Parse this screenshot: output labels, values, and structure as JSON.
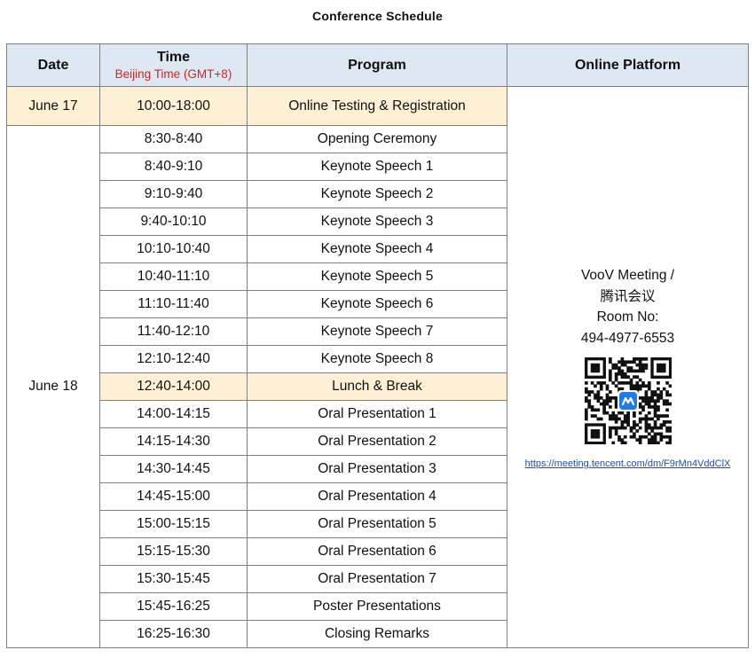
{
  "title": "Conference Schedule",
  "header": {
    "date": "Date",
    "time": "Time",
    "time_sub": "Beijing Time (GMT+8)",
    "program": "Program",
    "platform": "Online Platform"
  },
  "day1": {
    "date": "June 17",
    "time": "10:00-18:00",
    "program": "Online Testing & Registration"
  },
  "day2": {
    "date": "June 18",
    "slots": [
      {
        "time": "8:30-8:40",
        "program": "Opening Ceremony"
      },
      {
        "time": "8:40-9:10",
        "program": "Keynote Speech 1"
      },
      {
        "time": "9:10-9:40",
        "program": "Keynote Speech 2"
      },
      {
        "time": "9:40-10:10",
        "program": "Keynote Speech 3"
      },
      {
        "time": "10:10-10:40",
        "program": "Keynote Speech 4"
      },
      {
        "time": "10:40-11:10",
        "program": "Keynote Speech 5"
      },
      {
        "time": "11:10-11:40",
        "program": "Keynote Speech 6"
      },
      {
        "time": "11:40-12:10",
        "program": "Keynote Speech 7"
      },
      {
        "time": "12:10-12:40",
        "program": "Keynote Speech 8"
      },
      {
        "time": "12:40-14:00",
        "program": "Lunch & Break"
      },
      {
        "time": "14:00-14:15",
        "program": "Oral Presentation 1"
      },
      {
        "time": "14:15-14:30",
        "program": "Oral Presentation 2"
      },
      {
        "time": "14:30-14:45",
        "program": "Oral Presentation 3"
      },
      {
        "time": "14:45-15:00",
        "program": "Oral Presentation 4"
      },
      {
        "time": "15:00-15:15",
        "program": "Oral Presentation 5"
      },
      {
        "time": "15:15-15:30",
        "program": "Oral Presentation 6"
      },
      {
        "time": "15:30-15:45",
        "program": "Oral Presentation 7"
      },
      {
        "time": "15:45-16:25",
        "program": "Poster Presentations"
      },
      {
        "time": "16:25-16:30",
        "program": "Closing Remarks"
      }
    ]
  },
  "platform": {
    "line1": "VooV Meeting /",
    "line2": "腾讯会议",
    "line3": "Room No:",
    "room": "494-4977-6553",
    "link": "https://meeting.tencent.com/dm/F9rMn4VddClX",
    "qr_icon": "qr-code-icon"
  },
  "colors": {
    "header_bg": "#dde8f2",
    "highlight_bg": "#fdf0d4",
    "subtitle_red": "#e0201b",
    "link_blue": "#1f4ea8",
    "border": "#7f7f7f"
  }
}
